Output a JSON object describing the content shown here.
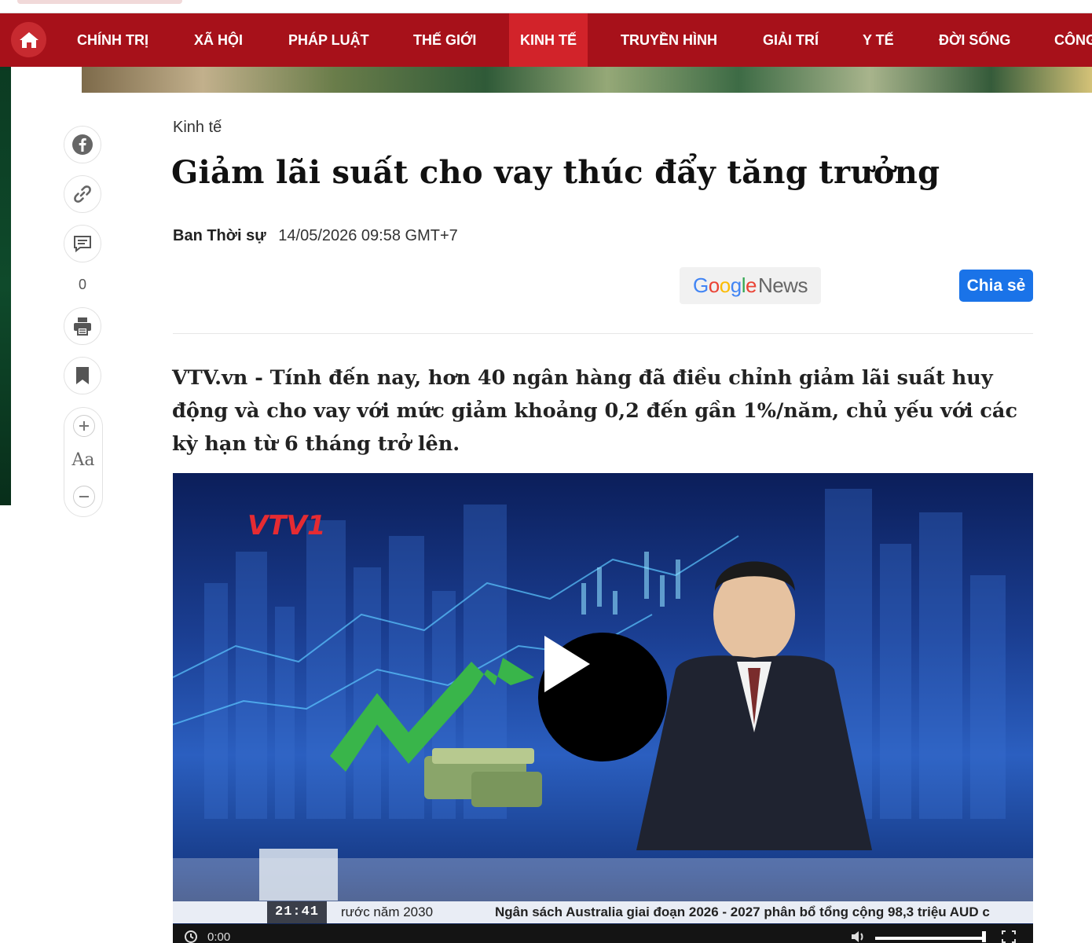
{
  "nav": {
    "items": [
      {
        "label": "CHÍNH TRỊ"
      },
      {
        "label": "XÃ HỘI"
      },
      {
        "label": "PHÁP LUẬT"
      },
      {
        "label": "THẾ GIỚI"
      },
      {
        "label": "KINH TẾ",
        "active": true
      },
      {
        "label": "TRUYỀN HÌNH"
      },
      {
        "label": "GIẢI TRÍ"
      },
      {
        "label": "Y TẾ"
      },
      {
        "label": "ĐỜI SỐNG"
      },
      {
        "label": "CÔNG"
      }
    ]
  },
  "sidebar": {
    "comment_count": "0",
    "font_label": "Aa"
  },
  "article": {
    "category": "Kinh tế",
    "title": "Giảm lãi suất cho vay thúc đẩy tăng trưởng",
    "author": "Ban Thời sự",
    "datetime": "14/05/2026 09:58 GMT+7",
    "share_label": "Chia sẻ",
    "lead": "VTV.vn - Tính đến nay, hơn 40 ngân hàng đã điều chỉnh giảm lãi suất huy động và cho vay với mức giảm khoảng 0,2 đến gần 1%/năm, chủ yếu với các kỳ hạn từ 6 tháng trở lên."
  },
  "google_news": {
    "g1": "G",
    "g2": "o",
    "g3": "o",
    "g4": "g",
    "g5": "l",
    "g6": "e",
    "news": "News"
  },
  "video": {
    "channel_logo": "VTV1",
    "ticker_time": "21:41",
    "ticker_text_1": "rước năm 2030",
    "ticker_text_2": "Ngân sách Australia giai đoạn 2026 - 2027 phân bổ tổng cộng 98,3 triệu AUD c",
    "current_time": "0:00"
  },
  "colors": {
    "nav_bg": "#a7111a",
    "nav_active": "#d2232a",
    "share_bg": "#1a73e8"
  }
}
